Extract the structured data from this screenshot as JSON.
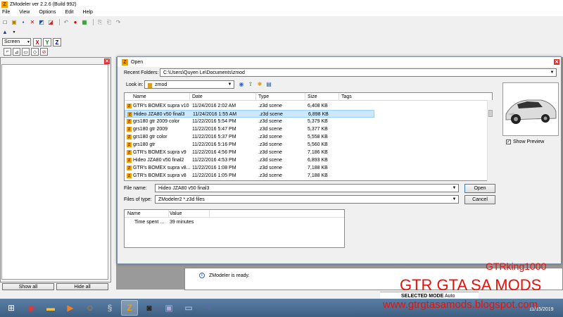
{
  "app": {
    "title": "ZModeler ver 2.2.6 (Build 992)",
    "logo_letter": "Z",
    "menu": [
      "File",
      "View",
      "Options",
      "Edit",
      "Help"
    ]
  },
  "toolbar2": {
    "screen_select": "Screen",
    "axes": [
      "X",
      "Y",
      "Z"
    ]
  },
  "left_panel": {
    "show_all": "Show all",
    "hide_all": "Hide all"
  },
  "status": {
    "message": "ZModeler is ready.",
    "mode_label": "SELECTED MODE",
    "mode_value": "Auto"
  },
  "dialog": {
    "title": "Open",
    "recent_folders_label": "Recent Folders:",
    "recent_folders_value": "C:\\Users\\Quyen Le\\Documents\\zmod",
    "look_in_label": "Look in:",
    "look_in_value": "zmod",
    "columns": [
      "Name",
      "Date",
      "Type",
      "Size",
      "Tags"
    ],
    "files": [
      {
        "name": "GTR's BOMEX supra v10",
        "date": "11/24/2016 2:02 AM",
        "type": ".z3d scene",
        "size": "6,408 KB"
      },
      {
        "name": "Hideo JZA80 v50 final3",
        "date": "11/24/2016 1:55 AM",
        "type": ".z3d scene",
        "size": "6,898 KB"
      },
      {
        "name": "grs180 gtr 2009 color",
        "date": "11/22/2016 5:54 PM",
        "type": ".z3d scene",
        "size": "5,379 KB"
      },
      {
        "name": "grs180 gtr 2009",
        "date": "11/22/2016 5:47 PM",
        "type": ".z3d scene",
        "size": "5,377 KB"
      },
      {
        "name": "grs180 gtr color",
        "date": "11/22/2016 5:37 PM",
        "type": ".z3d scene",
        "size": "5,558 KB"
      },
      {
        "name": "grs180 gtr",
        "date": "11/22/2016 5:16 PM",
        "type": ".z3d scene",
        "size": "5,560 KB"
      },
      {
        "name": "GTR's BOMEX supra v9",
        "date": "11/22/2016 4:56 PM",
        "type": ".z3d scene",
        "size": "7,186 KB"
      },
      {
        "name": "Hideo JZA80 v50 final2",
        "date": "11/22/2016 4:53 PM",
        "type": ".z3d scene",
        "size": "6,893 KB"
      },
      {
        "name": "GTR's BOMEX supra v8...",
        "date": "11/22/2016 1:08 PM",
        "type": ".z3d scene",
        "size": "7,188 KB"
      },
      {
        "name": "GTR's BOMEX supra v8",
        "date": "11/22/2016 1:05 PM",
        "type": ".z3d scene",
        "size": "7,188 KB"
      }
    ],
    "selected_index": 1,
    "show_preview_label": "Show Preview",
    "file_name_label": "File name:",
    "file_name_value": "Hideo JZA80 v50 final3",
    "files_of_type_label": "Files of type:",
    "files_of_type_value": "ZModeler2 *.z3d files",
    "open_button": "Open",
    "cancel_button": "Cancel",
    "prop_columns": [
      "Name",
      "Value"
    ],
    "props": [
      {
        "name": "Time spent ...",
        "value": "39 minutes"
      }
    ]
  },
  "overlay": {
    "author": "GTRking1000",
    "site_name": "GTR GTA SA MODS",
    "url": "www.gtrgtasamods.blogspot.com",
    "clock_date": "11/15/2019"
  },
  "colors": {
    "accent_red": "#e8100a",
    "selection": "#cce8ff",
    "taskbar": "#4a6d93"
  }
}
